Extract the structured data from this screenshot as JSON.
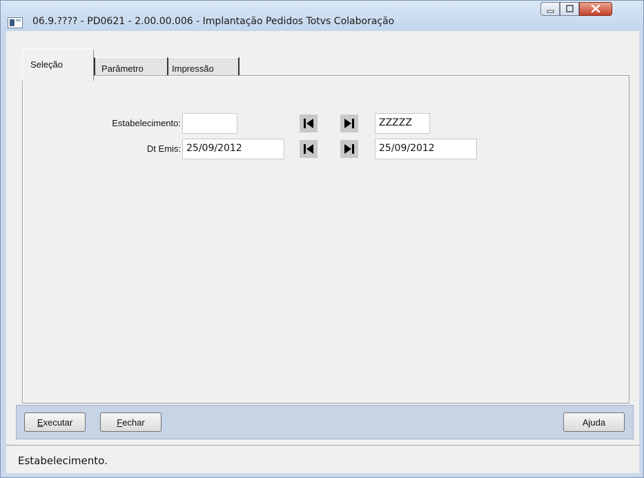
{
  "window": {
    "title": "06.9.???? - PD0621 - 2.00.00.006 - Implantação Pedidos Totvs Colaboração",
    "icon": "window-app-icon"
  },
  "tabs": [
    {
      "label": "Seleção",
      "active": true
    },
    {
      "label": "Parâmetro",
      "active": false
    },
    {
      "label": "Impressão",
      "active": false
    }
  ],
  "selection": {
    "estabelecimento": {
      "label": "Estabelecimento:",
      "from": "",
      "to": "ZZZZZ"
    },
    "dt_emis": {
      "label": "Dt Emis:",
      "from": "25/09/2012",
      "to": "25/09/2012"
    }
  },
  "buttons": {
    "executar": {
      "first": "E",
      "rest": "xecutar"
    },
    "fechar": {
      "first": "F",
      "rest": "echar"
    },
    "ajuda": {
      "pre": "A",
      "first": "j",
      "rest": "uda"
    }
  },
  "status": {
    "text": "Estabelecimento."
  },
  "icons": {
    "first": "first-record-icon",
    "last": "last-record-icon"
  },
  "colors": {
    "frame": "#c9d8ea",
    "client": "#f0f0f0",
    "bottom_bar": "#c6d4e6",
    "close": "#c5402a"
  }
}
